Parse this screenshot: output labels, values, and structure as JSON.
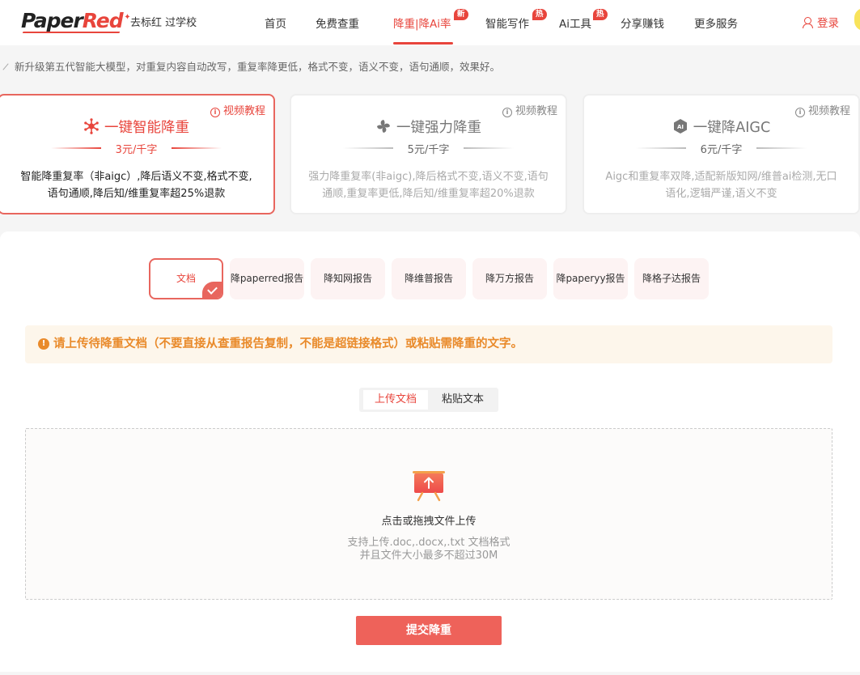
{
  "header": {
    "logo_part1": "Paper",
    "logo_part2": "Red",
    "slogan": "去标红 过学校",
    "nav": [
      {
        "label": "首页"
      },
      {
        "label": "免费查重"
      },
      {
        "label": "降重|降Ai率",
        "badge": "新"
      },
      {
        "label": "智能写作",
        "badge": "热"
      },
      {
        "label": "Ai工具",
        "badge": "热"
      },
      {
        "label": "分享赚钱"
      },
      {
        "label": "更多服务"
      }
    ],
    "login": "登录"
  },
  "info_text": "新升级第五代智能大模型，对重复内容自动改写，重复率降更低，格式不变，语义不变，语句通顺，效果好。",
  "modes": [
    {
      "title": "一键智能降重",
      "price": "3元/千字",
      "video": "视频教程",
      "desc_line1": "智能降重复率（非aigc）,降后语义不变,格式不变,",
      "desc_line2": "语句通顺,降后知/维重复率超25%退款"
    },
    {
      "title": "一键强力降重",
      "price": "5元/千字",
      "video": "视频教程",
      "desc_line1": "强力降重复率(非aigc),降后格式不变,语义不变,语句",
      "desc_line2": "通顺,重复率更低,降后知/维重复率超20%退款"
    },
    {
      "title": "一键降AIGC",
      "price": "6元/千字",
      "video": "视频教程",
      "ai_badge": "AI",
      "desc_line1": "Aigc和重复率双降,适配新版知网/维普ai检测,无口",
      "desc_line2": "语化,逻辑严谨,语义不变"
    }
  ],
  "report_tabs": [
    "文档",
    "降paperred报告",
    "降知网报告",
    "降维普报告",
    "降万方报告",
    "降paperyy报告",
    "降格子达报告"
  ],
  "notice": {
    "icon": "!",
    "text": "请上传待降重文档（不要直接从查重报告复制，不能是超链接格式）或粘贴需降重的文字。"
  },
  "upload_switch": {
    "upload": "上传文档",
    "paste": "粘贴文本"
  },
  "dropzone": {
    "title": "点击或拖拽文件上传",
    "hint_line1": "支持上传.doc,.docx,.txt 文档格式",
    "hint_line2": "并且文件大小最多不超过30M"
  },
  "submit_label": "提交降重",
  "colors": {
    "accent": "#e8453c",
    "warning": "#e98a2a",
    "submit": "#ee625a"
  }
}
